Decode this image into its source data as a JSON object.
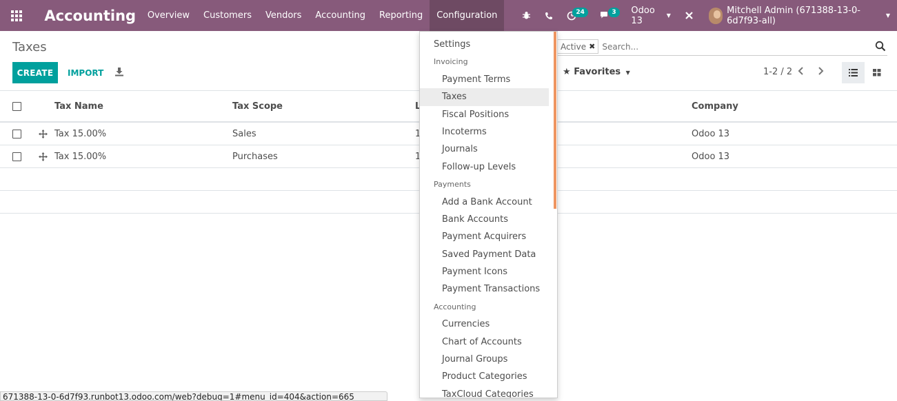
{
  "navbar": {
    "app_title": "Accounting",
    "menu": [
      "Overview",
      "Customers",
      "Vendors",
      "Accounting",
      "Reporting",
      "Configuration"
    ],
    "active_menu": "Configuration",
    "activity_count": "24",
    "message_count": "3",
    "company": "Odoo 13",
    "user": "Mitchell Admin (671388-13-0-6d7f93-all)",
    "color": "#875a7b"
  },
  "control": {
    "breadcrumb": "Taxes",
    "create_label": "CREATE",
    "import_label": "IMPORT",
    "facet_label": "Active",
    "search_placeholder": "Search...",
    "favorites_label": "Favorites",
    "pager": "1-2 / 2"
  },
  "table": {
    "headers": {
      "name": "Tax Name",
      "scope": "Tax Scope",
      "label": "L",
      "company": "Company"
    },
    "rows": [
      {
        "name": "Tax 15.00%",
        "scope": "Sales",
        "label": "1",
        "company": "Odoo 13"
      },
      {
        "name": "Tax 15.00%",
        "scope": "Purchases",
        "label": "1",
        "company": "Odoo 13"
      }
    ]
  },
  "config_menu": {
    "settings": "Settings",
    "sections": [
      {
        "header": "Invoicing",
        "items": [
          "Payment Terms",
          "Taxes",
          "Fiscal Positions",
          "Incoterms",
          "Journals",
          "Follow-up Levels"
        ]
      },
      {
        "header": "Payments",
        "items": [
          "Add a Bank Account",
          "Bank Accounts",
          "Payment Acquirers",
          "Saved Payment Data",
          "Payment Icons",
          "Payment Transactions"
        ]
      },
      {
        "header": "Accounting",
        "items": [
          "Currencies",
          "Chart of Accounts",
          "Journal Groups",
          "Product Categories",
          "TaxCloud Categories"
        ]
      }
    ],
    "active_item": "Taxes"
  },
  "status_url": "671388-13-0-6d7f93.runbot13.odoo.com/web?debug=1#menu_id=404&action=665",
  "colors": {
    "accent": "#00a09d",
    "navbar": "#875a7b",
    "scroll": "#ef9561"
  }
}
